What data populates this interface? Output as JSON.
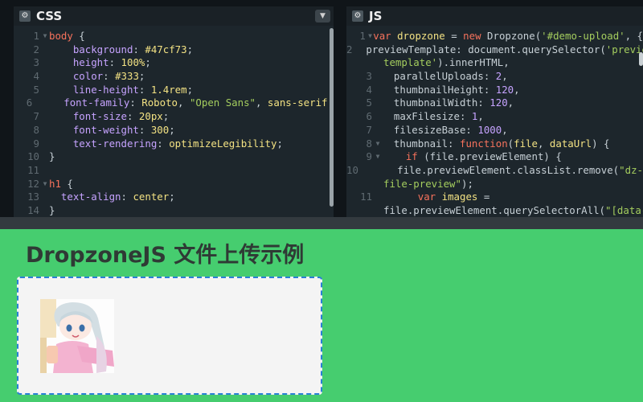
{
  "css_panel": {
    "title": "CSS",
    "lines": [
      {
        "n": "1",
        "fold": true,
        "tokens": [
          {
            "c": "k",
            "t": "body"
          },
          {
            "c": "pu",
            "t": " {"
          }
        ]
      },
      {
        "n": "2",
        "tokens": [
          {
            "c": "p",
            "t": "    background"
          },
          {
            "c": "pu",
            "t": ": "
          },
          {
            "c": "v",
            "t": "#47cf73"
          },
          {
            "c": "pu",
            "t": ";"
          }
        ]
      },
      {
        "n": "3",
        "tokens": [
          {
            "c": "p",
            "t": "    height"
          },
          {
            "c": "pu",
            "t": ": "
          },
          {
            "c": "v",
            "t": "100%"
          },
          {
            "c": "pu",
            "t": ";"
          }
        ]
      },
      {
        "n": "4",
        "tokens": [
          {
            "c": "p",
            "t": "    color"
          },
          {
            "c": "pu",
            "t": ": "
          },
          {
            "c": "v",
            "t": "#333"
          },
          {
            "c": "pu",
            "t": ";"
          }
        ]
      },
      {
        "n": "5",
        "tokens": [
          {
            "c": "p",
            "t": "    line-height"
          },
          {
            "c": "pu",
            "t": ": "
          },
          {
            "c": "v",
            "t": "1.4rem"
          },
          {
            "c": "pu",
            "t": ";"
          }
        ]
      },
      {
        "n": "6",
        "tokens": [
          {
            "c": "p",
            "t": "    font-family"
          },
          {
            "c": "pu",
            "t": ": "
          },
          {
            "c": "v",
            "t": "Roboto"
          },
          {
            "c": "pu",
            "t": ", "
          },
          {
            "c": "s",
            "t": "\"Open Sans\""
          },
          {
            "c": "pu",
            "t": ", "
          },
          {
            "c": "v",
            "t": "sans-serif"
          },
          {
            "c": "pu",
            "t": ";"
          }
        ]
      },
      {
        "n": "7",
        "tokens": [
          {
            "c": "p",
            "t": "    font-size"
          },
          {
            "c": "pu",
            "t": ": "
          },
          {
            "c": "v",
            "t": "20px"
          },
          {
            "c": "pu",
            "t": ";"
          }
        ]
      },
      {
        "n": "8",
        "tokens": [
          {
            "c": "p",
            "t": "    font-weight"
          },
          {
            "c": "pu",
            "t": ": "
          },
          {
            "c": "v",
            "t": "300"
          },
          {
            "c": "pu",
            "t": ";"
          }
        ]
      },
      {
        "n": "9",
        "tokens": [
          {
            "c": "p",
            "t": "    text-rendering"
          },
          {
            "c": "pu",
            "t": ": "
          },
          {
            "c": "v",
            "t": "optimizeLegibility"
          },
          {
            "c": "pu",
            "t": ";"
          }
        ]
      },
      {
        "n": "10",
        "tokens": [
          {
            "c": "pu",
            "t": "}"
          }
        ]
      },
      {
        "n": "11",
        "tokens": []
      },
      {
        "n": "12",
        "fold": true,
        "tokens": [
          {
            "c": "k",
            "t": "h1"
          },
          {
            "c": "pu",
            "t": " {"
          }
        ]
      },
      {
        "n": "13",
        "tokens": [
          {
            "c": "p",
            "t": "  text-align"
          },
          {
            "c": "pu",
            "t": ": "
          },
          {
            "c": "v",
            "t": "center"
          },
          {
            "c": "pu",
            "t": ";"
          }
        ]
      },
      {
        "n": "14",
        "tokens": [
          {
            "c": "pu",
            "t": "}"
          }
        ]
      }
    ]
  },
  "js_panel": {
    "title": "JS",
    "lines": [
      {
        "n": "1",
        "fold": true,
        "tokens": [
          {
            "c": "k",
            "t": "var"
          },
          {
            "c": "pu",
            "t": " "
          },
          {
            "c": "v",
            "t": "dropzone"
          },
          {
            "c": "pu",
            "t": " = "
          },
          {
            "c": "k",
            "t": "new"
          },
          {
            "c": "pu",
            "t": " Dropzone("
          },
          {
            "c": "s",
            "t": "'#demo-upload'"
          },
          {
            "c": "pu",
            "t": ", {"
          }
        ]
      },
      {
        "n": "2",
        "tokens": [
          {
            "c": "pu",
            "t": "  previewTemplate: document.querySelector("
          },
          {
            "c": "s",
            "t": "'previe"
          }
        ]
      },
      {
        "n": "",
        "wrap": true,
        "tokens": [
          {
            "c": "s",
            "t": "template'"
          },
          {
            "c": "pu",
            "t": ").innerHTML,"
          }
        ]
      },
      {
        "n": "3",
        "tokens": [
          {
            "c": "pu",
            "t": "  parallelUploads: "
          },
          {
            "c": "p",
            "t": "2"
          },
          {
            "c": "pu",
            "t": ","
          }
        ]
      },
      {
        "n": "4",
        "tokens": [
          {
            "c": "pu",
            "t": "  thumbnailHeight: "
          },
          {
            "c": "p",
            "t": "120"
          },
          {
            "c": "pu",
            "t": ","
          }
        ]
      },
      {
        "n": "5",
        "tokens": [
          {
            "c": "pu",
            "t": "  thumbnailWidth: "
          },
          {
            "c": "p",
            "t": "120"
          },
          {
            "c": "pu",
            "t": ","
          }
        ]
      },
      {
        "n": "6",
        "tokens": [
          {
            "c": "pu",
            "t": "  maxFilesize: "
          },
          {
            "c": "p",
            "t": "1"
          },
          {
            "c": "pu",
            "t": ","
          }
        ]
      },
      {
        "n": "7",
        "tokens": [
          {
            "c": "pu",
            "t": "  filesizeBase: "
          },
          {
            "c": "p",
            "t": "1000"
          },
          {
            "c": "pu",
            "t": ","
          }
        ]
      },
      {
        "n": "8",
        "fold": true,
        "tokens": [
          {
            "c": "pu",
            "t": "  thumbnail: "
          },
          {
            "c": "k",
            "t": "function"
          },
          {
            "c": "pu",
            "t": "("
          },
          {
            "c": "v",
            "t": "file"
          },
          {
            "c": "pu",
            "t": ", "
          },
          {
            "c": "v",
            "t": "dataUrl"
          },
          {
            "c": "pu",
            "t": ") {"
          }
        ]
      },
      {
        "n": "9",
        "fold": true,
        "tokens": [
          {
            "c": "pu",
            "t": "    "
          },
          {
            "c": "k",
            "t": "if"
          },
          {
            "c": "pu",
            "t": " (file.previewElement) {"
          }
        ]
      },
      {
        "n": "10",
        "tokens": [
          {
            "c": "pu",
            "t": "      file.previewElement.classList.remove("
          },
          {
            "c": "s",
            "t": "\"dz-"
          }
        ]
      },
      {
        "n": "",
        "wrap": true,
        "tokens": [
          {
            "c": "s",
            "t": "file-preview\""
          },
          {
            "c": "pu",
            "t": ");"
          }
        ]
      },
      {
        "n": "11",
        "tokens": [
          {
            "c": "pu",
            "t": "      "
          },
          {
            "c": "k",
            "t": "var"
          },
          {
            "c": "pu",
            "t": " "
          },
          {
            "c": "v",
            "t": "images"
          },
          {
            "c": "pu",
            "t": " ="
          }
        ]
      },
      {
        "n": "",
        "wrap": true,
        "tokens": [
          {
            "c": "pu",
            "t": "file.previewElement.querySelectorAll("
          },
          {
            "c": "s",
            "t": "\"[data-dz-"
          }
        ]
      }
    ]
  },
  "result": {
    "heading": "DropzoneJS 文件上传示例"
  },
  "colors": {
    "accent": "#46cd6f",
    "editor_bg": "#1d262c",
    "dropzone_border": "#2a7fd6"
  }
}
